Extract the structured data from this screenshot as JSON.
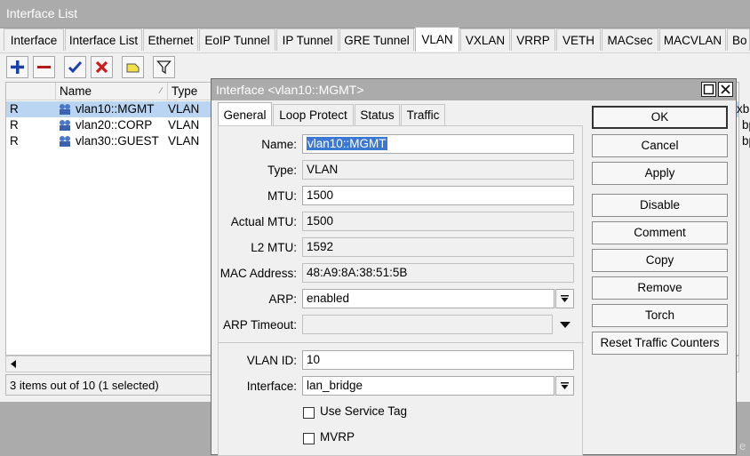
{
  "list_window": {
    "title": "Interface List",
    "tabs": [
      "Interface",
      "Interface List",
      "Ethernet",
      "EoIP Tunnel",
      "IP Tunnel",
      "GRE Tunnel",
      "VLAN",
      "VXLAN",
      "VRRP",
      "VETH",
      "MACsec",
      "MACVLAN",
      "Bo"
    ],
    "active_tab": "VLAN",
    "toolbar": [
      "add-icon",
      "remove-icon",
      "enable-icon",
      "disable-icon",
      "comment-icon",
      "filter-icon"
    ],
    "columns": [
      "Name",
      "Type"
    ],
    "rows": [
      {
        "flag": "R",
        "name": "vlan10::MGMT",
        "type": "VLAN",
        "tail": "xbp",
        "selected": true
      },
      {
        "flag": "R",
        "name": "vlan20::CORP",
        "type": "VLAN",
        "tail": "bp",
        "selected": false
      },
      {
        "flag": "R",
        "name": "vlan30::GUEST",
        "type": "VLAN",
        "tail": "bp",
        "selected": false
      }
    ],
    "status": "3 items out of 10 (1 selected)",
    "trailing_glyph": "e"
  },
  "dialog": {
    "title": "Interface <vlan10::MGMT>",
    "tabs": [
      "General",
      "Loop Protect",
      "Status",
      "Traffic"
    ],
    "active_tab": "General",
    "fields": {
      "name": {
        "label": "Name:",
        "value": "vlan10::MGMT"
      },
      "type": {
        "label": "Type:",
        "value": "VLAN"
      },
      "mtu": {
        "label": "MTU:",
        "value": "1500"
      },
      "actual_mtu": {
        "label": "Actual MTU:",
        "value": "1500"
      },
      "l2_mtu": {
        "label": "L2 MTU:",
        "value": "1592"
      },
      "mac": {
        "label": "MAC Address:",
        "value": "48:A9:8A:38:51:5B"
      },
      "arp": {
        "label": "ARP:",
        "value": "enabled"
      },
      "arp_timeout": {
        "label": "ARP Timeout:",
        "value": ""
      },
      "vlan_id": {
        "label": "VLAN ID:",
        "value": "10"
      },
      "interface": {
        "label": "Interface:",
        "value": "lan_bridge"
      }
    },
    "checkboxes": {
      "service_tag": {
        "label": "Use Service Tag",
        "checked": false
      },
      "mvrp": {
        "label": "MVRP",
        "checked": false
      }
    },
    "buttons": {
      "ok": "OK",
      "cancel": "Cancel",
      "apply": "Apply",
      "disable": "Disable",
      "comment": "Comment",
      "copy": "Copy",
      "remove": "Remove",
      "torch": "Torch",
      "reset": "Reset Traffic Counters"
    }
  },
  "colors": {
    "selection": "#b9d5f1",
    "titlebar": "#ababab",
    "name_highlight": "#3a78d4"
  }
}
